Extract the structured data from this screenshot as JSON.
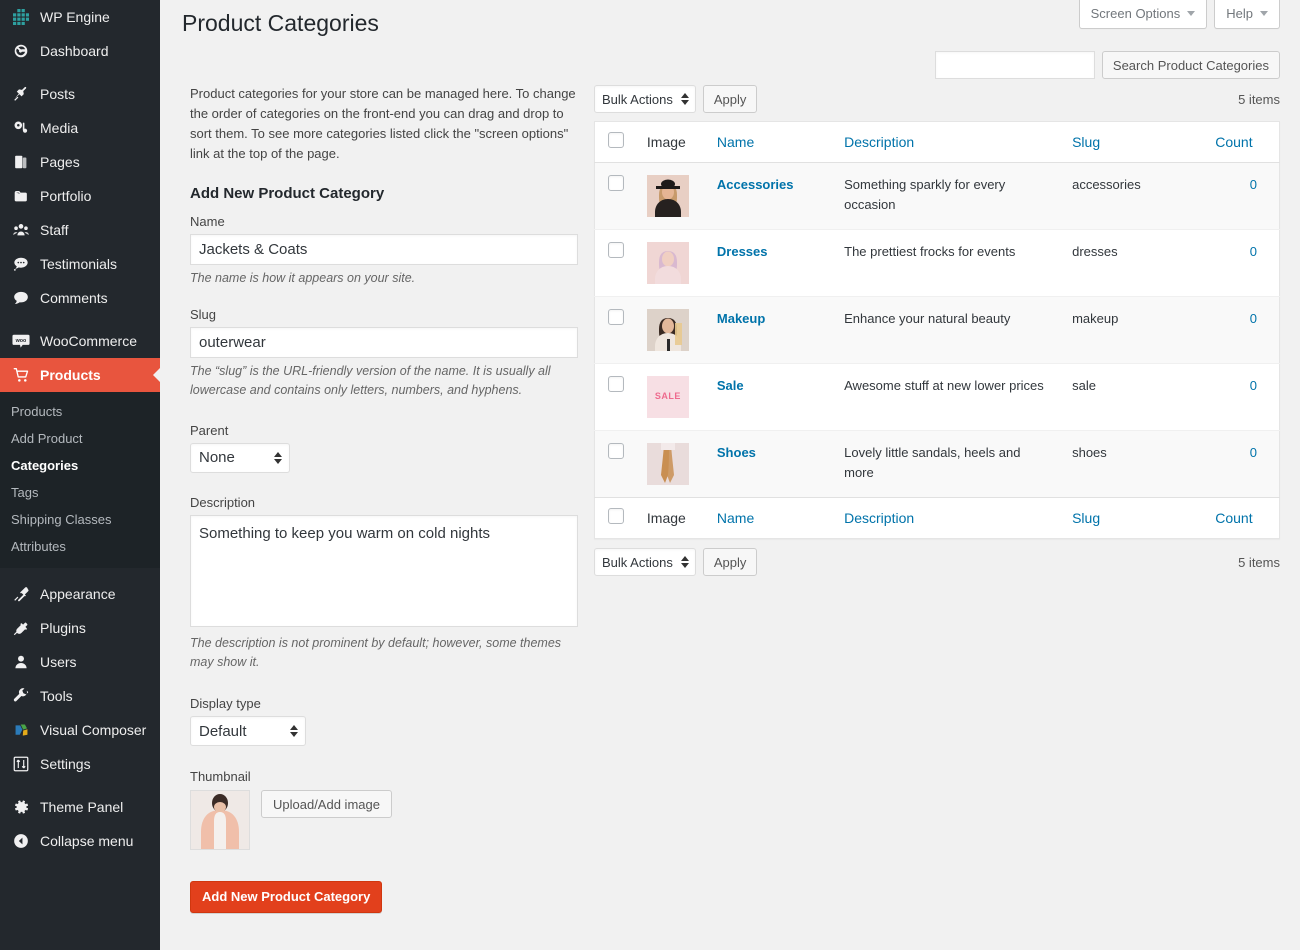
{
  "sidebar": {
    "items": [
      {
        "label": "WP Engine",
        "icon": "wpengine-grid-icon",
        "name": "sidebar-item-wp-engine"
      },
      {
        "label": "Dashboard",
        "icon": "dashboard-gauge-icon",
        "name": "sidebar-item-dashboard"
      },
      {
        "label": "Posts",
        "icon": "pin-icon",
        "name": "sidebar-item-posts",
        "gap_before": true
      },
      {
        "label": "Media",
        "icon": "media-icon",
        "name": "sidebar-item-media"
      },
      {
        "label": "Pages",
        "icon": "pages-icon",
        "name": "sidebar-item-pages"
      },
      {
        "label": "Portfolio",
        "icon": "portfolio-folder-icon",
        "name": "sidebar-item-portfolio"
      },
      {
        "label": "Staff",
        "icon": "staff-group-icon",
        "name": "sidebar-item-staff"
      },
      {
        "label": "Testimonials",
        "icon": "testimonial-bubble-icon",
        "name": "sidebar-item-testimonials"
      },
      {
        "label": "Comments",
        "icon": "comment-bubble-icon",
        "name": "sidebar-item-comments"
      },
      {
        "label": "WooCommerce",
        "icon": "woocommerce-icon",
        "name": "sidebar-item-woocommerce",
        "gap_before": true
      },
      {
        "label": "Products",
        "icon": "cart-icon",
        "name": "sidebar-item-products",
        "current": true
      }
    ],
    "submenu": [
      {
        "label": "Products",
        "name": "submenu-item-products"
      },
      {
        "label": "Add Product",
        "name": "submenu-item-add-product"
      },
      {
        "label": "Categories",
        "name": "submenu-item-categories",
        "current": true
      },
      {
        "label": "Tags",
        "name": "submenu-item-tags"
      },
      {
        "label": "Shipping Classes",
        "name": "submenu-item-shipping-classes"
      },
      {
        "label": "Attributes",
        "name": "submenu-item-attributes"
      }
    ],
    "items_after": [
      {
        "label": "Appearance",
        "icon": "brush-icon",
        "name": "sidebar-item-appearance",
        "gap_before": true
      },
      {
        "label": "Plugins",
        "icon": "plugin-icon",
        "name": "sidebar-item-plugins"
      },
      {
        "label": "Users",
        "icon": "user-icon",
        "name": "sidebar-item-users"
      },
      {
        "label": "Tools",
        "icon": "wrench-icon",
        "name": "sidebar-item-tools"
      },
      {
        "label": "Visual Composer",
        "icon": "visual-composer-icon",
        "name": "sidebar-item-visual-composer"
      },
      {
        "label": "Settings",
        "icon": "sliders-icon",
        "name": "sidebar-item-settings"
      },
      {
        "label": "Theme Panel",
        "icon": "gear-icon",
        "name": "sidebar-item-theme-panel",
        "gap_before": true
      },
      {
        "label": "Collapse menu",
        "icon": "collapse-arrow-icon",
        "name": "sidebar-item-collapse-menu"
      }
    ],
    "colors": {
      "background": "#23282d",
      "submenu_background": "#1d2327",
      "current_highlight": "#e8553e"
    }
  },
  "header": {
    "screen_options_label": "Screen Options",
    "help_label": "Help",
    "page_title": "Product Categories"
  },
  "search": {
    "value": "",
    "placeholder": "",
    "button_label": "Search Product Categories"
  },
  "form": {
    "intro": "Product categories for your store can be managed here. To change the order of categories on the front-end you can drag and drop to sort them. To see more categories listed click the \"screen options\" link at the top of the page.",
    "heading": "Add New Product Category",
    "name_label": "Name",
    "name_value": "Jackets & Coats",
    "name_desc": "The name is how it appears on your site.",
    "slug_label": "Slug",
    "slug_value": "outerwear",
    "slug_desc": "The “slug” is the URL-friendly version of the name. It is usually all lowercase and contains only letters, numbers, and hyphens.",
    "parent_label": "Parent",
    "parent_value": "None",
    "description_label": "Description",
    "description_value": "Something to keep you warm on cold nights",
    "description_desc": "The description is not prominent by default; however, some themes may show it.",
    "display_type_label": "Display type",
    "display_type_value": "Default",
    "thumbnail_label": "Thumbnail",
    "upload_button_label": "Upload/Add image",
    "submit_label": "Add New Product Category",
    "submit_color": "#e2401c"
  },
  "tablenav": {
    "bulk_actions_label": "Bulk Actions",
    "apply_label": "Apply",
    "items_count": "5 items"
  },
  "table": {
    "columns": [
      {
        "label": "Image",
        "link": false,
        "name": "column-image"
      },
      {
        "label": "Name",
        "link": true,
        "name": "column-name"
      },
      {
        "label": "Description",
        "link": true,
        "name": "column-description"
      },
      {
        "label": "Slug",
        "link": true,
        "name": "column-slug"
      },
      {
        "label": "Count",
        "link": true,
        "name": "column-count"
      }
    ],
    "rows": [
      {
        "name": "Accessories",
        "description": "Something sparkly for every occasion",
        "slug": "accessories",
        "count": "0",
        "thumb": "photo-accessories"
      },
      {
        "name": "Dresses",
        "description": "The prettiest frocks for events",
        "slug": "dresses",
        "count": "0",
        "thumb": "photo-dresses"
      },
      {
        "name": "Makeup",
        "description": "Enhance your natural beauty",
        "slug": "makeup",
        "count": "0",
        "thumb": "photo-makeup"
      },
      {
        "name": "Sale",
        "description": "Awesome stuff at new lower prices",
        "slug": "sale",
        "count": "0",
        "thumb": "sale-badge",
        "thumb_text": "SALE"
      },
      {
        "name": "Shoes",
        "description": "Lovely little sandals, heels and more",
        "slug": "shoes",
        "count": "0",
        "thumb": "photo-shoes"
      }
    ],
    "link_color": "#0073aa"
  }
}
